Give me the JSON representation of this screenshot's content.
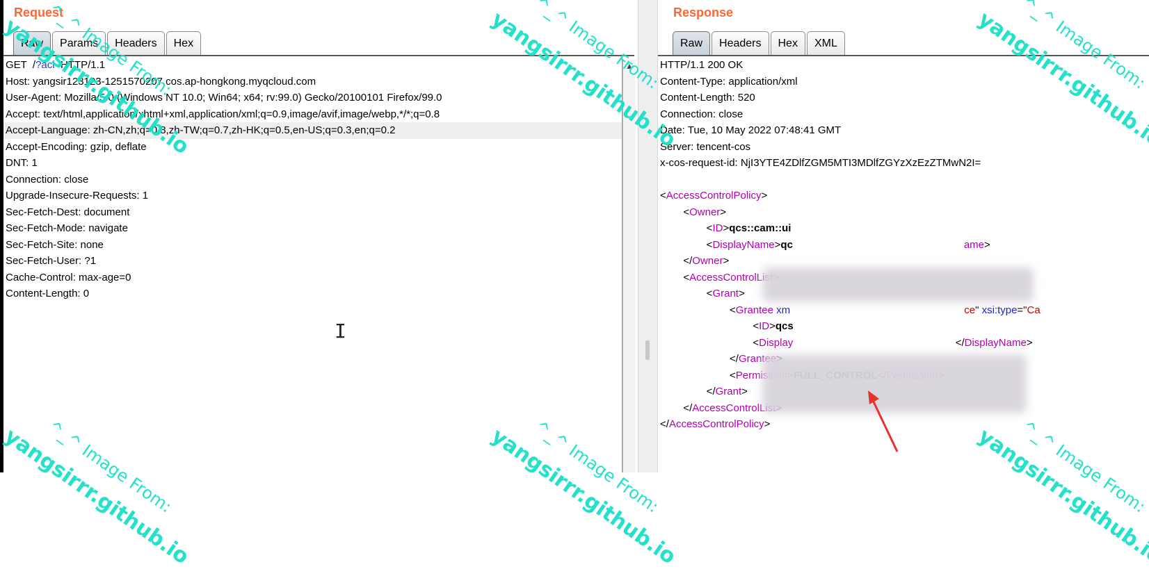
{
  "request": {
    "title": "Request",
    "tabs": [
      "Raw",
      "Params",
      "Headers",
      "Hex"
    ],
    "active_tab": 0,
    "lines": [
      {
        "parts": [
          {
            "t": "GET  /"
          },
          {
            "t": "?acl",
            "c": "blue"
          },
          {
            "t": "  HTTP/1.1"
          }
        ]
      },
      {
        "parts": [
          {
            "t": "Host: yangsir123123-1251570207.cos.ap-hongkong.myqcloud.com"
          }
        ]
      },
      {
        "parts": [
          {
            "t": "User-Agent: Mozilla/5.0 (Windows NT 10.0; Win64; x64; rv:99.0) Gecko/20100101 Firefox/99.0"
          }
        ]
      },
      {
        "parts": [
          {
            "t": "Accept: text/html,application/xhtml+xml,application/xml;q=0.9,image/avif,image/webp,*/*;q=0.8"
          }
        ]
      },
      {
        "parts": [
          {
            "t": "Accept-Language: zh-CN,zh;q=0.8,zh-TW;q=0.7,zh-HK;q=0.5,en-US;q=0.3,en;q=0.2"
          }
        ],
        "hl": true
      },
      {
        "parts": [
          {
            "t": "Accept-Encoding: gzip, deflate"
          }
        ]
      },
      {
        "parts": [
          {
            "t": "DNT: 1"
          }
        ]
      },
      {
        "parts": [
          {
            "t": "Connection: close"
          }
        ]
      },
      {
        "parts": [
          {
            "t": "Upgrade-Insecure-Requests: 1"
          }
        ]
      },
      {
        "parts": [
          {
            "t": "Sec-Fetch-Dest: document"
          }
        ]
      },
      {
        "parts": [
          {
            "t": "Sec-Fetch-Mode: navigate"
          }
        ]
      },
      {
        "parts": [
          {
            "t": "Sec-Fetch-Site: none"
          }
        ]
      },
      {
        "parts": [
          {
            "t": "Sec-Fetch-User: ?1"
          }
        ]
      },
      {
        "parts": [
          {
            "t": "Cache-Control: max-age=0"
          }
        ]
      },
      {
        "parts": [
          {
            "t": "Content-Length: 0"
          }
        ]
      }
    ]
  },
  "response": {
    "title": "Response",
    "tabs": [
      "Raw",
      "Headers",
      "Hex",
      "XML"
    ],
    "active_tab": 0,
    "lines": [
      {
        "parts": [
          {
            "t": "HTTP/1.1 200 OK"
          }
        ]
      },
      {
        "parts": [
          {
            "t": "Content-Type: application/xml"
          }
        ]
      },
      {
        "parts": [
          {
            "t": "Content-Length: 520"
          }
        ]
      },
      {
        "parts": [
          {
            "t": "Connection: close"
          }
        ]
      },
      {
        "parts": [
          {
            "t": "Date: Tue, 10 May 2022 07:48:41 GMT"
          }
        ]
      },
      {
        "parts": [
          {
            "t": "Server: tencent-cos"
          }
        ]
      },
      {
        "parts": [
          {
            "t": "x-cos-request-id: NjI3YTE4ZDlfZGM5MTI3MDlfZGYzXzEzZTMwN2I="
          }
        ]
      },
      {
        "parts": [
          {
            "t": ""
          }
        ]
      },
      {
        "parts": [
          {
            "t": "<",
            "c": "punct"
          },
          {
            "t": "AccessControlPolicy",
            "c": "tag"
          },
          {
            "t": ">",
            "c": "punct"
          }
        ]
      },
      {
        "parts": [
          {
            "t": "        <"
          },
          {
            "t": "Owner",
            "c": "tag"
          },
          {
            "t": ">"
          }
        ]
      },
      {
        "parts": [
          {
            "t": "                <"
          },
          {
            "t": "ID",
            "c": "tag"
          },
          {
            "t": ">"
          },
          {
            "t": "qcs::cam::ui",
            "c": "bold"
          }
        ]
      },
      {
        "parts": [
          {
            "t": "                <"
          },
          {
            "t": "DisplayName",
            "c": "tag"
          },
          {
            "t": ">"
          },
          {
            "t": "qc",
            "c": "bold"
          },
          {
            "t": "                                                           "
          },
          {
            "t": "ame",
            "c": "tag"
          },
          {
            "t": ">"
          }
        ]
      },
      {
        "parts": [
          {
            "t": "        </"
          },
          {
            "t": "Owner",
            "c": "tag"
          },
          {
            "t": ">"
          }
        ]
      },
      {
        "parts": [
          {
            "t": "        <"
          },
          {
            "t": "AccessControlList",
            "c": "tag"
          },
          {
            "t": ">"
          }
        ]
      },
      {
        "parts": [
          {
            "t": "                <"
          },
          {
            "t": "Grant",
            "c": "tag"
          },
          {
            "t": ">"
          }
        ]
      },
      {
        "parts": [
          {
            "t": "                        <"
          },
          {
            "t": "Grantee",
            "c": "tag"
          },
          {
            "t": " xm",
            "c": "attr"
          },
          {
            "t": "                                                            "
          },
          {
            "t": "ce",
            "c": "strval"
          },
          {
            "t": "\" "
          },
          {
            "t": "xsi:type",
            "c": "attr"
          },
          {
            "t": "=\""
          },
          {
            "t": "Ca",
            "c": "strval"
          }
        ]
      },
      {
        "parts": [
          {
            "t": "                                <"
          },
          {
            "t": "ID",
            "c": "tag"
          },
          {
            "t": ">"
          },
          {
            "t": "qcs",
            "c": "bold"
          }
        ]
      },
      {
        "parts": [
          {
            "t": "                                <"
          },
          {
            "t": "Display",
            "c": "tag"
          },
          {
            "t": "                                                        </"
          },
          {
            "t": "DisplayName",
            "c": "tag"
          },
          {
            "t": ">"
          }
        ]
      },
      {
        "parts": [
          {
            "t": "                        </"
          },
          {
            "t": "Grantee",
            "c": "tag"
          },
          {
            "t": ">"
          }
        ]
      },
      {
        "parts": [
          {
            "t": "                        <"
          },
          {
            "t": "Permission",
            "c": "tag"
          },
          {
            "t": ">"
          },
          {
            "t": "FULL_CONTROL",
            "c": "bold"
          },
          {
            "t": "</"
          },
          {
            "t": "Permission",
            "c": "tag"
          },
          {
            "t": ">"
          }
        ]
      },
      {
        "parts": [
          {
            "t": "                </"
          },
          {
            "t": "Grant",
            "c": "tag"
          },
          {
            "t": ">"
          }
        ]
      },
      {
        "parts": [
          {
            "t": "        </"
          },
          {
            "t": "AccessControlList",
            "c": "tag"
          },
          {
            "t": ">"
          }
        ]
      },
      {
        "parts": [
          {
            "t": "</"
          },
          {
            "t": "AccessControlPolicy",
            "c": "tag"
          },
          {
            "t": ">"
          }
        ]
      }
    ]
  },
  "watermark": {
    "site": "yangsirrr.github.io",
    "caption": "^_^ Image From:"
  },
  "colors": {
    "title": "#ff6633",
    "tag": "#b000b0",
    "watermark": "#19e0c8",
    "arrow": "#e8322c"
  },
  "icons": {
    "text_cursor": "I-beam",
    "scroll_up": "▲"
  }
}
